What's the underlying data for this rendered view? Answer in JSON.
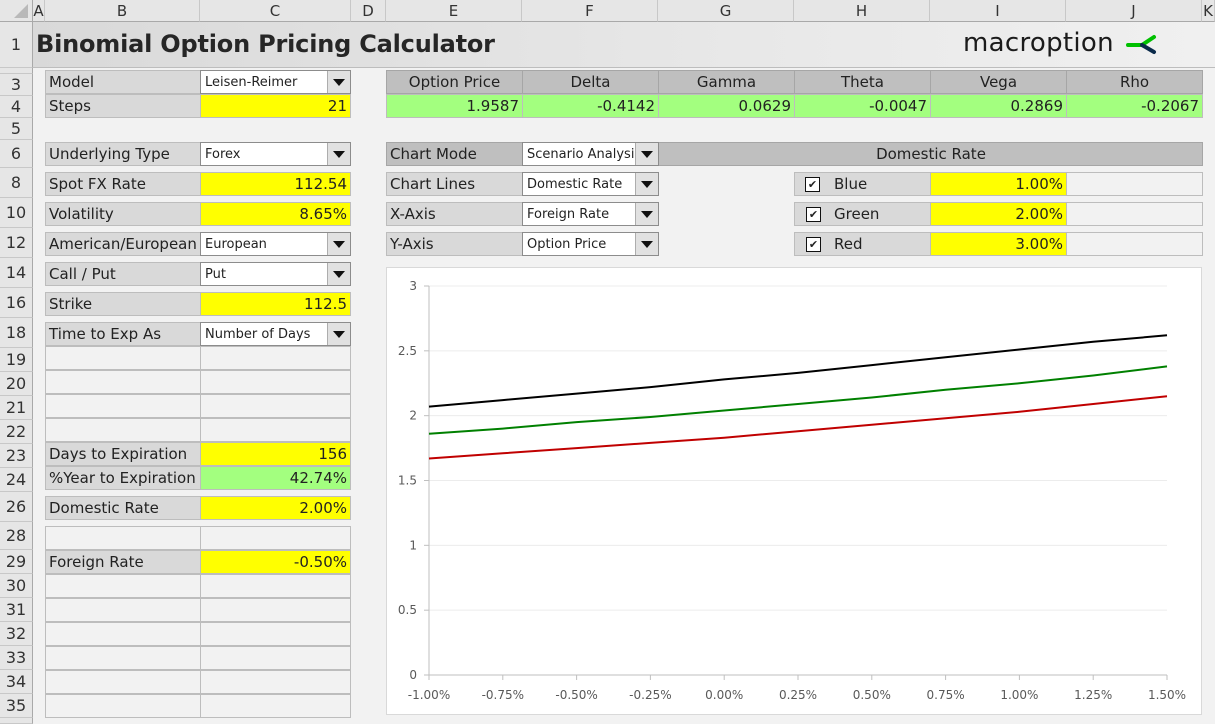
{
  "sheet": {
    "columns": [
      "A",
      "B",
      "C",
      "D",
      "E",
      "F",
      "G",
      "H",
      "I",
      "J",
      "K"
    ],
    "rows": [
      "1",
      "3",
      "4",
      "5",
      "6",
      "8",
      "10",
      "12",
      "14",
      "16",
      "18",
      "19",
      "20",
      "21",
      "22",
      "23",
      "24",
      "26",
      "28",
      "29",
      "30",
      "31",
      "32",
      "33",
      "34",
      "35"
    ]
  },
  "header": {
    "title": "Binomial Option Pricing Calculator",
    "logo_text": "macroption",
    "logo_icon": "macroption-logo-icon"
  },
  "inputs": {
    "model": {
      "label": "Model",
      "value": "Leisen-Reimer"
    },
    "steps": {
      "label": "Steps",
      "value": "21"
    },
    "underlying_type": {
      "label": "Underlying Type",
      "value": "Forex"
    },
    "spot": {
      "label": "Spot FX Rate",
      "value": "112.54"
    },
    "volatility": {
      "label": "Volatility",
      "value": "8.65%"
    },
    "exercise": {
      "label": "American/European",
      "value": "European"
    },
    "call_put": {
      "label": "Call / Put",
      "value": "Put"
    },
    "strike": {
      "label": "Strike",
      "value": "112.5"
    },
    "time_as": {
      "label": "Time to Exp As",
      "value": "Number of Days"
    },
    "days": {
      "label": "Days to Expiration",
      "value": "156"
    },
    "pct_year": {
      "label": "%Year to Expiration",
      "value": "42.74%"
    },
    "domestic_rate": {
      "label": "Domestic Rate",
      "value": "2.00%"
    },
    "foreign_rate": {
      "label": "Foreign Rate",
      "value": "-0.50%"
    }
  },
  "results": {
    "headers": [
      "Option Price",
      "Delta",
      "Gamma",
      "Theta",
      "Vega",
      "Rho"
    ],
    "values": [
      "1.9587",
      "-0.4142",
      "0.0629",
      "-0.0047",
      "0.2869",
      "-0.2067"
    ]
  },
  "chart_settings": {
    "mode": {
      "label": "Chart Mode",
      "value": "Scenario Analysis"
    },
    "lines": {
      "label": "Chart Lines",
      "value": "Domestic Rate"
    },
    "xaxis": {
      "label": "X-Axis",
      "value": "Foreign Rate"
    },
    "yaxis": {
      "label": "Y-Axis",
      "value": "Option Price"
    },
    "lines_header": "Domestic Rate",
    "series": [
      {
        "name": "Blue",
        "checked": true,
        "value": "1.00%"
      },
      {
        "name": "Green",
        "checked": true,
        "value": "2.00%"
      },
      {
        "name": "Red",
        "checked": true,
        "value": "3.00%"
      }
    ]
  },
  "chart_data": {
    "type": "line",
    "title": "",
    "xlabel": "Foreign Rate",
    "ylabel": "Option Price",
    "x": [
      -1.0,
      -0.75,
      -0.5,
      -0.25,
      0.0,
      0.25,
      0.5,
      0.75,
      1.0,
      1.25,
      1.5
    ],
    "xticks": [
      "-1.00%",
      "-0.75%",
      "-0.50%",
      "-0.25%",
      "0.00%",
      "0.25%",
      "0.50%",
      "0.75%",
      "1.00%",
      "1.25%",
      "1.50%"
    ],
    "yticks": [
      "0",
      "0.5",
      "1",
      "1.5",
      "2",
      "2.5",
      "3"
    ],
    "xlim": [
      -1.0,
      1.5
    ],
    "ylim": [
      0,
      3
    ],
    "grid": true,
    "legend": "none",
    "series": [
      {
        "name": "Domestic Rate 1.00%",
        "color": "#000000",
        "values": [
          2.07,
          2.12,
          2.17,
          2.22,
          2.28,
          2.33,
          2.39,
          2.45,
          2.51,
          2.57,
          2.62
        ]
      },
      {
        "name": "Domestic Rate 2.00%",
        "color": "#008000",
        "values": [
          1.86,
          1.9,
          1.95,
          1.99,
          2.04,
          2.09,
          2.14,
          2.2,
          2.25,
          2.31,
          2.38
        ]
      },
      {
        "name": "Domestic Rate 3.00%",
        "color": "#c00000",
        "values": [
          1.67,
          1.71,
          1.75,
          1.79,
          1.83,
          1.88,
          1.93,
          1.98,
          2.03,
          2.09,
          2.15
        ]
      }
    ]
  }
}
